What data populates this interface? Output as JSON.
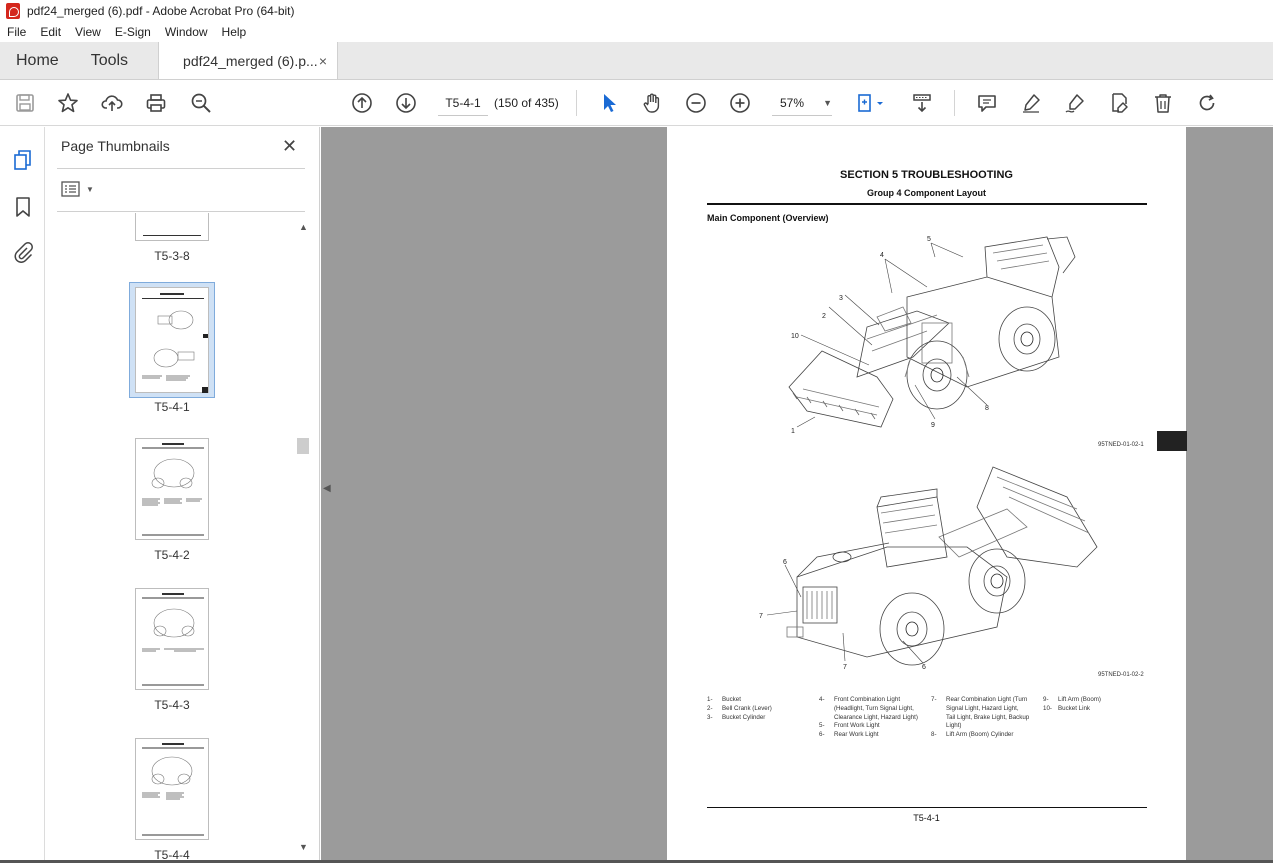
{
  "window": {
    "title": "pdf24_merged (6).pdf - Adobe Acrobat Pro (64-bit)"
  },
  "menu": [
    "File",
    "Edit",
    "View",
    "E-Sign",
    "Window",
    "Help"
  ],
  "tabs": {
    "home": "Home",
    "tools": "Tools",
    "document": "pdf24_merged (6).p...",
    "close": "×"
  },
  "toolbar": {
    "page_label": "T5-4-1",
    "page_count": "(150 of 435)",
    "zoom": "57%"
  },
  "panel": {
    "title": "Page Thumbnails",
    "thumbnails": [
      {
        "label": "T5-3-8"
      },
      {
        "label": "T5-4-1",
        "selected": true
      },
      {
        "label": "T5-4-2"
      },
      {
        "label": "T5-4-3"
      },
      {
        "label": "T5-4-4"
      }
    ]
  },
  "page": {
    "section": "SECTION 5 TROUBLESHOOTING",
    "group": "Group 4 Component Layout",
    "heading": "Main Component (Overview)",
    "fig1_code": "95TNED-01-02-1",
    "fig2_code": "95TNED-01-02-2",
    "callouts_fig1": [
      "1",
      "2",
      "3",
      "4",
      "5",
      "8",
      "9",
      "10"
    ],
    "callouts_fig2": [
      "6",
      "7",
      "7",
      "6"
    ],
    "legend": [
      [
        {
          "n": "1-",
          "t": "Bucket"
        },
        {
          "n": "2-",
          "t": "Bell Crank (Lever)"
        },
        {
          "n": "3-",
          "t": "Bucket Cylinder"
        }
      ],
      [
        {
          "n": "4-",
          "t": "Front Combination Light"
        },
        {
          "n": "",
          "t": "(Headlight, Turn Signal Light,"
        },
        {
          "n": "",
          "t": "Clearance Light, Hazard Light)"
        },
        {
          "n": "5-",
          "t": "Front Work Light"
        },
        {
          "n": "6-",
          "t": "Rear Work Light"
        }
      ],
      [
        {
          "n": "7-",
          "t": "Rear Combination Light (Turn"
        },
        {
          "n": "",
          "t": "Signal Light, Hazard Light,"
        },
        {
          "n": "",
          "t": "Tail Light, Brake Light, Backup"
        },
        {
          "n": "",
          "t": "Light)"
        },
        {
          "n": "8-",
          "t": "Lift Arm (Boom) Cylinder"
        }
      ],
      [
        {
          "n": "9-",
          "t": "Lift Arm (Boom)"
        },
        {
          "n": "10-",
          "t": "Bucket Link"
        }
      ]
    ],
    "page_number": "T5-4-1"
  }
}
